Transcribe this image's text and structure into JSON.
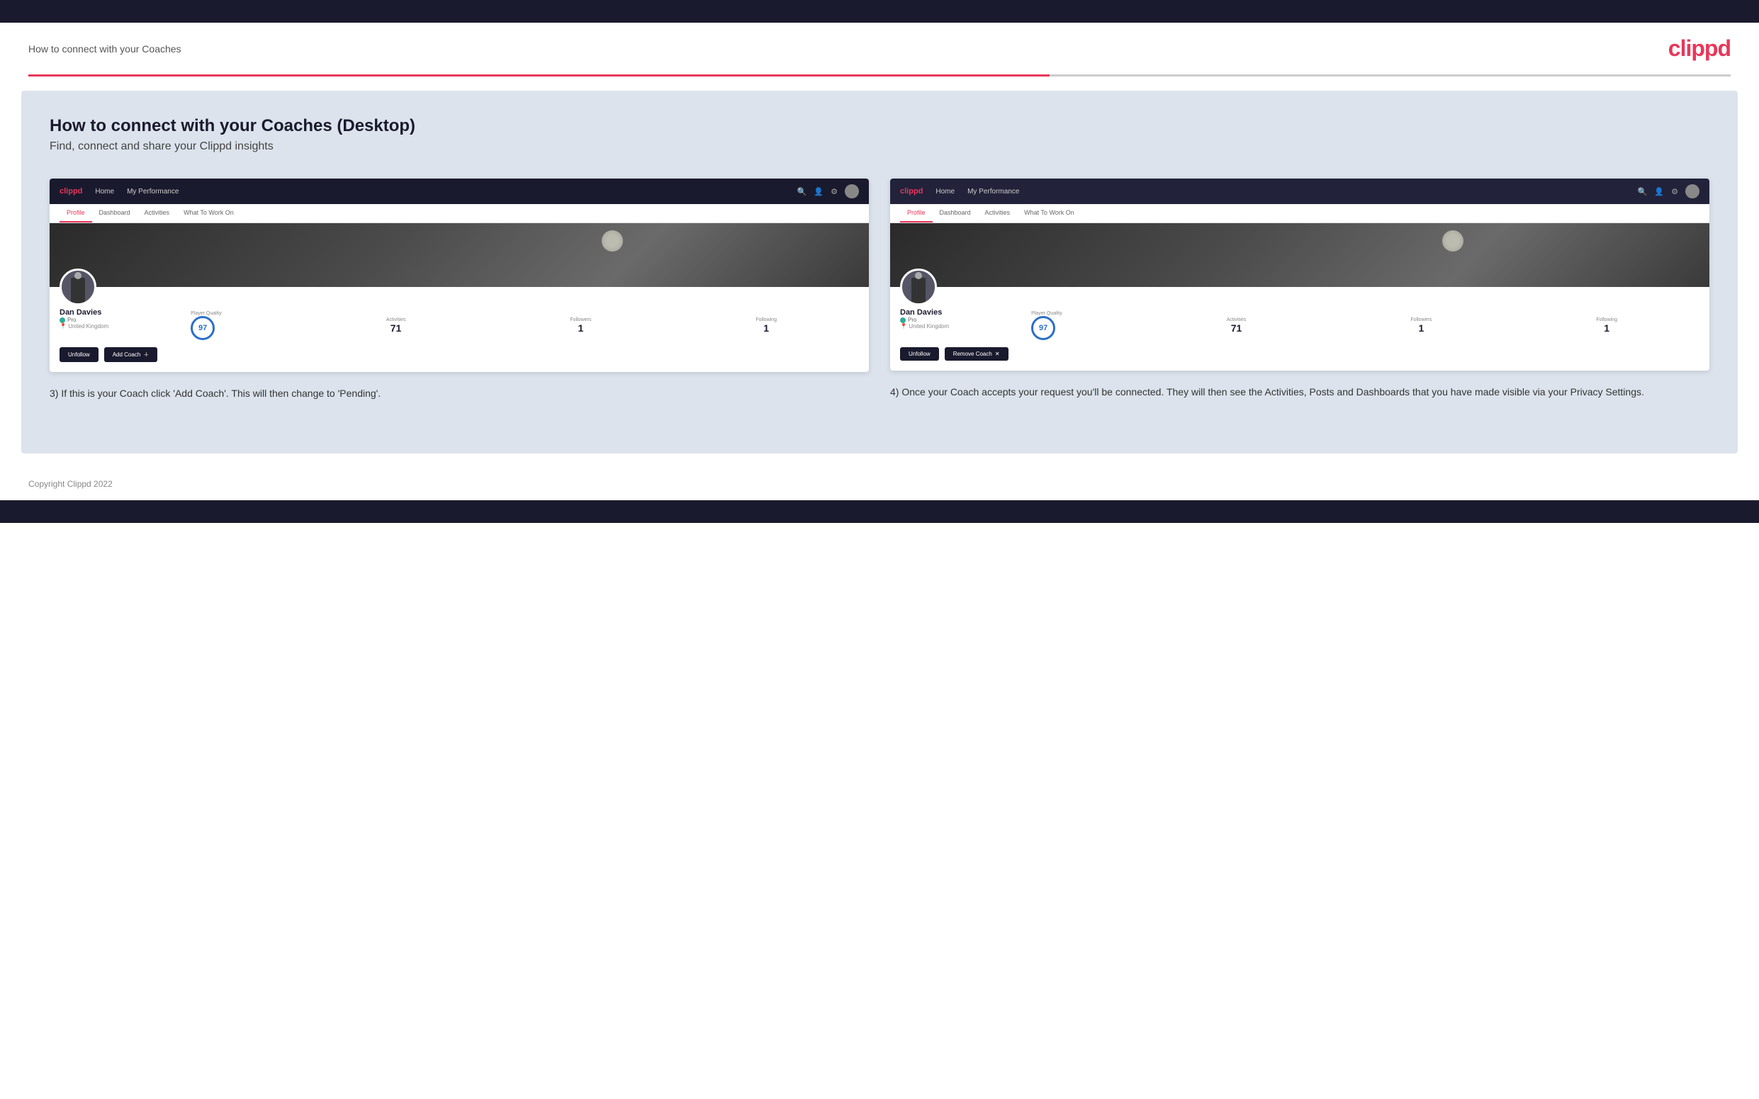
{
  "topBar": {},
  "header": {
    "title": "How to connect with your Coaches",
    "logo": "clippd"
  },
  "main": {
    "heading": "How to connect with your Coaches (Desktop)",
    "subheading": "Find, connect and share your Clippd insights",
    "screenshot1": {
      "nav": {
        "logo": "clippd",
        "items": [
          "Home",
          "My Performance"
        ]
      },
      "tabs": [
        "Profile",
        "Dashboard",
        "Activities",
        "What To Work On"
      ],
      "activeTab": "Profile",
      "profile": {
        "name": "Dan Davies",
        "role": "Pro",
        "location": "United Kingdom",
        "playerQuality": "97",
        "activities": "71",
        "followers": "1",
        "following": "1",
        "buttons": [
          "Unfollow",
          "Add Coach"
        ]
      },
      "labels": {
        "playerQuality": "Player Quality",
        "activities": "Activities",
        "followers": "Followers",
        "following": "Following"
      }
    },
    "screenshot2": {
      "nav": {
        "logo": "clippd",
        "items": [
          "Home",
          "My Performance"
        ]
      },
      "tabs": [
        "Profile",
        "Dashboard",
        "Activities",
        "What To Work On"
      ],
      "activeTab": "Profile",
      "profile": {
        "name": "Dan Davies",
        "role": "Pro",
        "location": "United Kingdom",
        "playerQuality": "97",
        "activities": "71",
        "followers": "1",
        "following": "1",
        "buttons": [
          "Unfollow",
          "Remove Coach"
        ]
      },
      "labels": {
        "playerQuality": "Player Quality",
        "activities": "Activities",
        "followers": "Followers",
        "following": "Following"
      }
    },
    "caption1": "3) If this is your Coach click 'Add Coach'. This will then change to 'Pending'.",
    "caption2": "4) Once your Coach accepts your request you'll be connected. They will then see the Activities, Posts and Dashboards that you have made visible via your Privacy Settings.",
    "footer": "Copyright Clippd 2022"
  }
}
